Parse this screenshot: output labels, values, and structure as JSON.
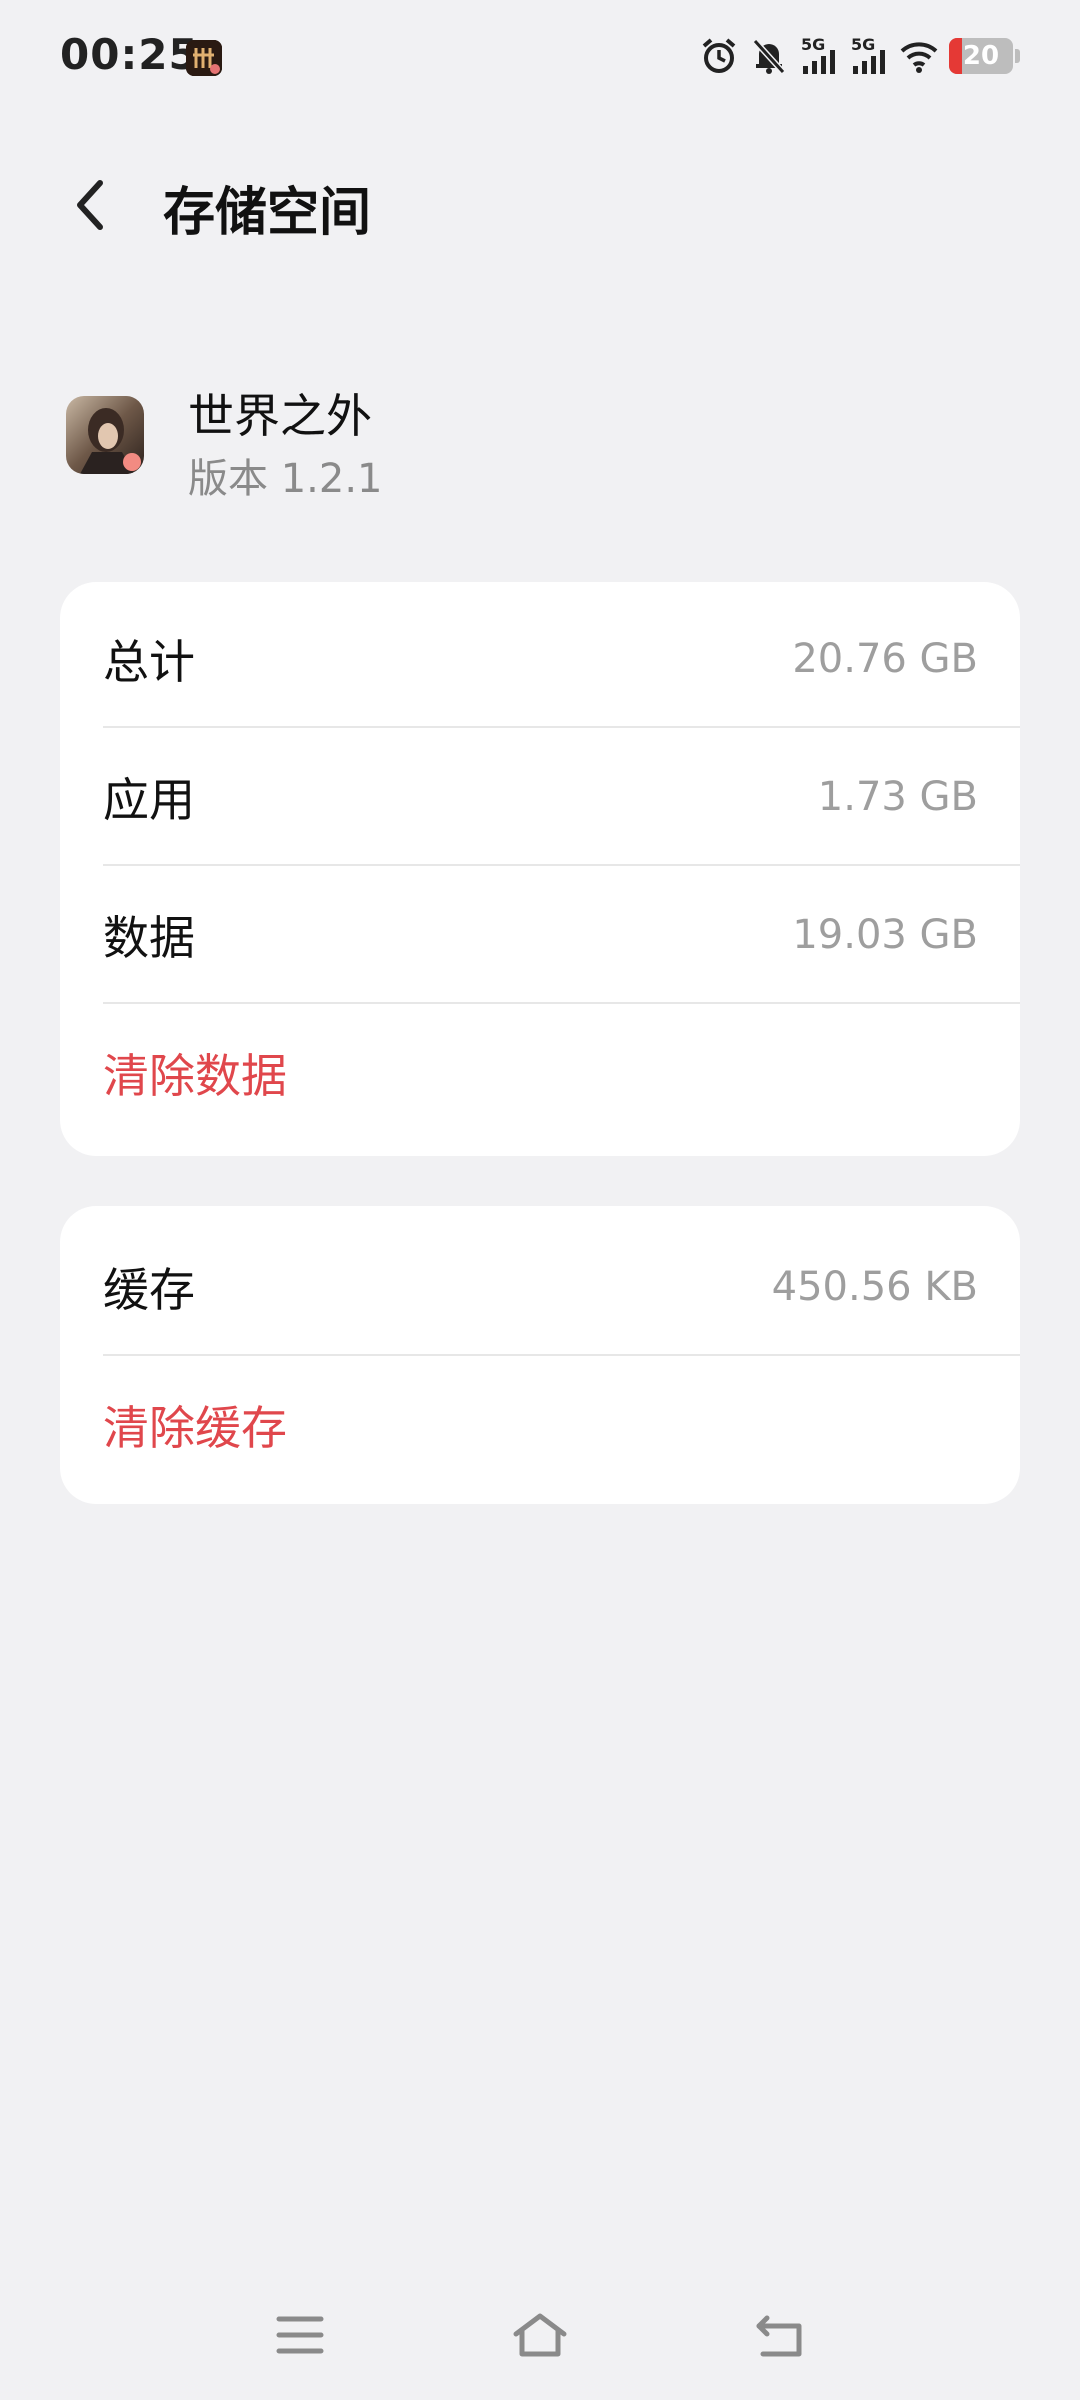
{
  "status_bar": {
    "time": "00:25",
    "signal1_label": "5G",
    "signal2_label": "5G",
    "battery_level": "20",
    "battery_color": "#e53935"
  },
  "header": {
    "title": "存储空间",
    "back_icon": "chevron-left-icon"
  },
  "app": {
    "name": "世界之外",
    "version": "版本 1.2.1"
  },
  "storage_card": {
    "rows": [
      {
        "label": "总计",
        "value": "20.76 GB"
      },
      {
        "label": "应用",
        "value": "1.73 GB"
      },
      {
        "label": "数据",
        "value": "19.03 GB"
      }
    ],
    "action": "清除数据"
  },
  "cache_card": {
    "label": "缓存",
    "value": "450.56 KB",
    "action": "清除缓存"
  },
  "colors": {
    "background": "#f1f1f3",
    "card": "#ffffff",
    "danger": "#e0474c",
    "secondary_text": "#9e9e9e"
  },
  "nav_bar": {
    "icons": [
      "menu-icon",
      "home-icon",
      "back-icon"
    ]
  }
}
